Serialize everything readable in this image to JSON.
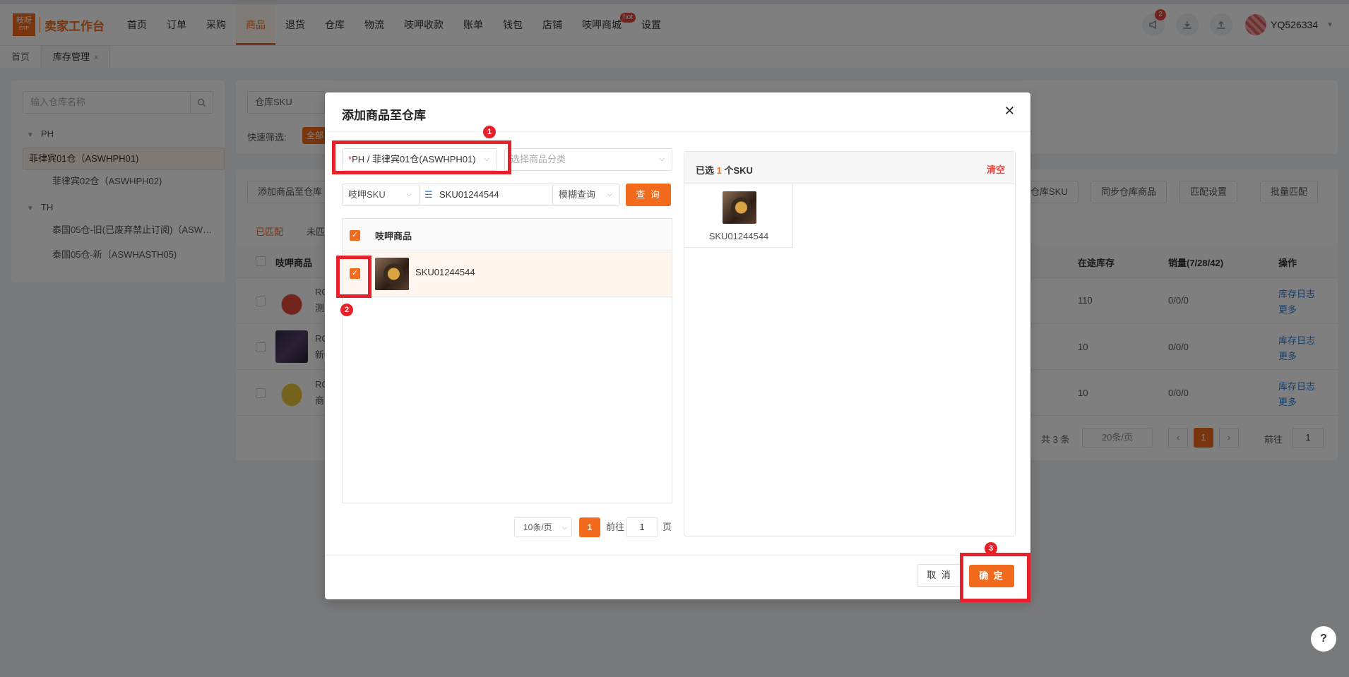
{
  "header": {
    "logo_text": "吱呀",
    "logo_sub": "ERP",
    "brand": "卖家工作台",
    "nav": [
      "首页",
      "订单",
      "采购",
      "商品",
      "退货",
      "仓库",
      "物流",
      "吱呷收款",
      "账单",
      "钱包",
      "店铺",
      "吱呷商城",
      "设置"
    ],
    "hot_badge": "hot",
    "notification_count": "2",
    "username": "YQ526334"
  },
  "tabs": {
    "home": "首页",
    "inventory": "库存管理",
    "close": "×"
  },
  "left_panel": {
    "search_placeholder": "输入仓库名称",
    "groups": [
      {
        "name": "PH",
        "items": [
          "菲律宾01仓（ASWHPH01)",
          "菲律宾02仓（ASWHPH02)"
        ]
      },
      {
        "name": "TH",
        "items": [
          "泰国05仓-旧(已废弃禁止订阅)（ASW…",
          "泰国05仓-新（ASWHASTH05)"
        ]
      }
    ]
  },
  "background": {
    "sku_select": "仓库SKU",
    "quick_filter": "快速筛选:",
    "quick_all": "全部",
    "add_button": "添加商品至仓库",
    "wh_sku_btn": "仓库SKU",
    "sync_btn": "同步仓库商品",
    "match_setting": "匹配设置",
    "batch_match": "批量匹配",
    "tab_matched": "已匹配",
    "tab_unmatched": "未匹",
    "col_product": "吱呷商品",
    "col_transit": "在途库存",
    "col_sales": "销量(7/28/42)",
    "col_action": "操作",
    "rows": [
      {
        "c1": "RC",
        "c2": "测",
        "transit": "110",
        "sales": "0/0/0"
      },
      {
        "c1": "RC",
        "c2": "新",
        "transit": "10",
        "sales": "0/0/0"
      },
      {
        "c1": "RC",
        "c2": "商",
        "transit": "10",
        "sales": "0/0/0"
      }
    ],
    "link_log": "库存日志",
    "link_more": "更多",
    "total": "共 3 条",
    "page_size": "20条/页",
    "page": "1",
    "goto": "前往",
    "goto_val": "1"
  },
  "modal": {
    "title": "添加商品至仓库",
    "warehouse_req": "*",
    "warehouse": "PH / 菲律宾01仓(ASWHPH01)",
    "category_placeholder": "选择商品分类",
    "sku_type": "吱呷SKU",
    "sku_query": "SKU01244544",
    "match_mode": "模糊查询",
    "query_btn": "查 询",
    "table_header": "吱呷商品",
    "products": [
      {
        "name": "SKU01244544",
        "checked": true
      }
    ],
    "page_size": "10条/页",
    "page": "1",
    "goto": "前往",
    "goto_val": "1",
    "page_unit": "页",
    "selected_prefix": "已选",
    "selected_count": "1",
    "selected_suffix": "个SKU",
    "clear": "清空",
    "selected_items": [
      "SKU01244544"
    ],
    "cancel": "取 消",
    "ok": "确 定"
  },
  "annotations": [
    "1",
    "2",
    "3"
  ],
  "help": "?"
}
